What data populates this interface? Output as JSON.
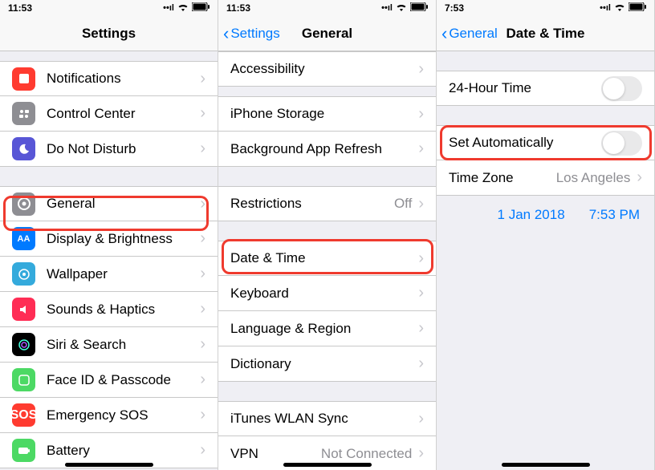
{
  "statusbar": {
    "time_a": "11:53",
    "time_b": "11:53",
    "time_c": "7:53"
  },
  "panel1": {
    "title": "Settings",
    "rows": {
      "notifications": "Notifications",
      "control_center": "Control Center",
      "dnd": "Do Not Disturb",
      "general": "General",
      "display": "Display & Brightness",
      "wallpaper": "Wallpaper",
      "sounds": "Sounds & Haptics",
      "siri": "Siri & Search",
      "faceid": "Face ID & Passcode",
      "sos": "Emergency SOS",
      "sos_icon": "SOS",
      "battery": "Battery"
    }
  },
  "panel2": {
    "back": "Settings",
    "title": "General",
    "rows": {
      "accessibility": "Accessibility",
      "storage": "iPhone Storage",
      "background": "Background App Refresh",
      "restrictions": "Restrictions",
      "restrictions_value": "Off",
      "datetime": "Date & Time",
      "keyboard": "Keyboard",
      "language": "Language & Region",
      "dictionary": "Dictionary",
      "itunes": "iTunes WLAN Sync",
      "vpn": "VPN",
      "vpn_value": "Not Connected"
    }
  },
  "panel3": {
    "back": "General",
    "title": "Date & Time",
    "rows": {
      "h24": "24-Hour Time",
      "auto": "Set Automatically",
      "timezone": "Time Zone",
      "timezone_value": "Los Angeles",
      "date": "1 Jan 2018",
      "time": "7:53 PM"
    }
  }
}
